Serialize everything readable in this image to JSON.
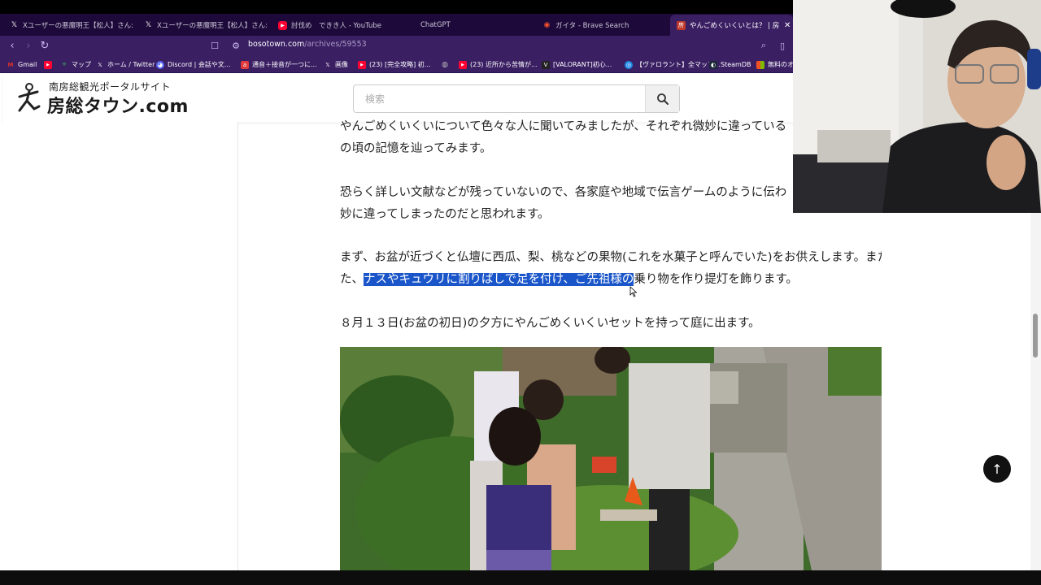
{
  "browser": {
    "tabs": [
      {
        "label": "Xユーザーの悪魔明王【松人】さん: 「https:",
        "icon": "x-icon"
      },
      {
        "label": "Xユーザーの悪魔明王【松人】さん: 「https:",
        "icon": "x-icon"
      },
      {
        "label": "討伐め　できき人 - YouTube",
        "icon": "youtube-icon"
      },
      {
        "label": "ChatGPT",
        "icon": "chatgpt-icon"
      },
      {
        "label": "ガイタ - Brave Search",
        "icon": "brave-icon"
      },
      {
        "label": "やんごめくいくいとは？ | 房総タウン",
        "icon": "site-icon"
      }
    ],
    "url_host": "bosotown.com",
    "url_path": "/archives/59553",
    "bookmarks": [
      {
        "label": "Gmail",
        "color": "#d93025"
      },
      {
        "label": "",
        "color": "#ff0033"
      },
      {
        "label": "マップ",
        "color": "#34a853"
      },
      {
        "label": "ホーム / Twitter",
        "color": "#000000"
      },
      {
        "label": "Discord | 会話や文...",
        "color": "#5865f2"
      },
      {
        "label": "通音＋接音が一つに...",
        "color": "#e03a3a"
      },
      {
        "label": "画像",
        "color": "#000000"
      },
      {
        "label": "(23) [完全攻略] 初...",
        "color": "#ff0033"
      },
      {
        "label": "",
        "color": "#888888"
      },
      {
        "label": "(23) 近所から苦情が...",
        "color": "#ff0033"
      },
      {
        "label": "[VALORANT]初心...",
        "color": "#222222"
      },
      {
        "label": "【ヴァロラント】全マップ...",
        "color": "#1e88e5"
      },
      {
        "label": "SteamDB",
        "color": "#1b2838"
      },
      {
        "label": "無料のオ",
        "color": "#f25022"
      }
    ]
  },
  "site": {
    "subtitle": "南房総観光ポータルサイト",
    "name": "房総タウン.com",
    "search_placeholder": "検索"
  },
  "article": {
    "p1_line1": "やんごめくいくいについて色々な人に聞いてみましたが、それぞれ微妙に違っている",
    "p1_line2": "の頃の記憶を辿ってみます。",
    "p2_line1": "恐らく詳しい文献などが残っていないので、各家庭や地域で伝言ゲームのように伝わ",
    "p2_line2": "妙に違ってしまったのだと思われます。",
    "p3_line1": "まず、お盆が近づくと仏壇に西瓜、梨、桃などの果物(これを水菓子と呼んでいた)をお供えします。また、",
    "p3_prefix": "た、",
    "p3_highlight": "ナスやキュウリに割りばしで足を付け、ご先祖様の",
    "p3_suffix": "乗り物を作り提灯を飾ります。",
    "p4": "８月１３日(お盆の初日)の夕方にやんごめくいくいセットを持って庭に出ます。"
  },
  "colors": {
    "tabbar": "#1e0a3a",
    "toolbar": "#3a1f63",
    "highlight": "#1a56c9"
  }
}
